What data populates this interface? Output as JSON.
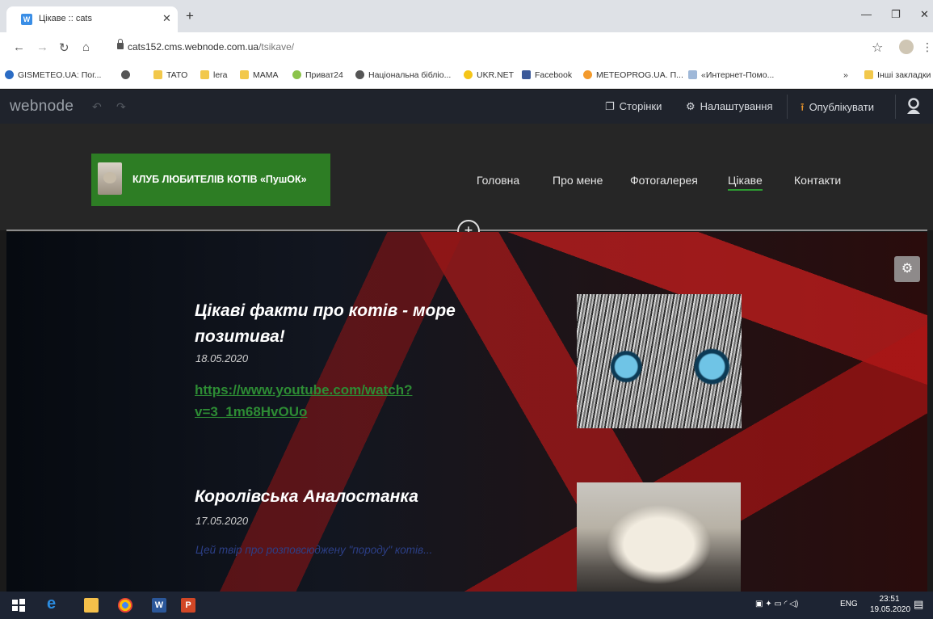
{
  "browser": {
    "tab_title": "Цікаве :: cats",
    "tab_favicon": "W",
    "url_host": "cats152.cms.webnode.com.ua",
    "url_path": "/tsikave/",
    "bookmarks": [
      {
        "label": "GISMETEO.UA: Пог...",
        "icon": "gismeteo-icon",
        "color": "#2b6cc4"
      },
      {
        "label": "",
        "icon": "globe-icon",
        "color": "#555555"
      },
      {
        "label": "TATO",
        "icon": "folder-icon",
        "color": "#f2c84b"
      },
      {
        "label": "lera",
        "icon": "folder-icon",
        "color": "#f2c84b"
      },
      {
        "label": "MAMA",
        "icon": "folder-icon",
        "color": "#f2c84b"
      },
      {
        "label": "Приват24",
        "icon": "privat24-icon",
        "color": "#8bc34a"
      },
      {
        "label": "Національна бібліо...",
        "icon": "globe-icon",
        "color": "#555555"
      },
      {
        "label": "UKR.NET",
        "icon": "ukrnet-icon",
        "color": "#f5c518"
      },
      {
        "label": "Facebook",
        "icon": "facebook-icon",
        "color": "#3b5998"
      },
      {
        "label": "METEOPROG.UA. П...",
        "icon": "meteoprog-icon",
        "color": "#f39a2c"
      },
      {
        "label": "«Интернет-Помо...",
        "icon": "page-icon",
        "color": "#9fb8d8"
      }
    ],
    "bookmarks_more": "»",
    "other_bookmarks": "Інші закладки"
  },
  "editor": {
    "logo": "webnode",
    "pages_label": "Сторінки",
    "settings_label": "Налаштування",
    "publish_label": "Опублікувати"
  },
  "site": {
    "logo_text": "КЛУБ ЛЮБИТЕЛІВ КОТІВ «ПушОК»",
    "menu": [
      {
        "label": "Головна",
        "active": false
      },
      {
        "label": "Про мене",
        "active": false
      },
      {
        "label": "Фотогалерея",
        "active": false
      },
      {
        "label": "Цікаве",
        "active": true
      },
      {
        "label": "Контакти",
        "active": false
      }
    ],
    "add_section": "+"
  },
  "posts": [
    {
      "title_line1": "Цікаві факти про котів - море",
      "title_line2": "позитива!",
      "date": "18.05.2020",
      "link_line1": "https://www.youtube.com/watch?",
      "link_line2": "v=3_1m68HvOUo"
    },
    {
      "title_line1": "Королівська Аналостанка",
      "date": "17.05.2020",
      "excerpt": "Цей твір про розповсюджену \"породу\" котів..."
    }
  ],
  "taskbar": {
    "language": "ENG",
    "time": "23:51",
    "date": "19.05.2020"
  },
  "colors": {
    "accent_green": "#2d7d24",
    "link_green": "#2d8c34",
    "editor_bg": "#1f232c",
    "publish_orange": "#f39a2c"
  }
}
